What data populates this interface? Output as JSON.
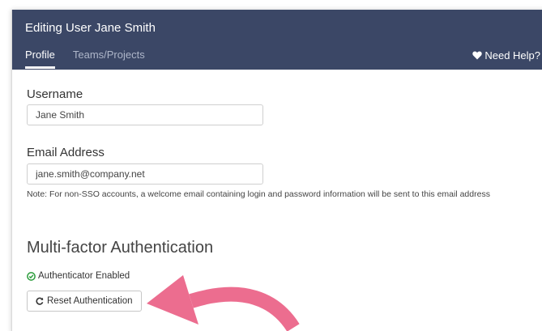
{
  "header": {
    "title": "Editing User Jane Smith",
    "tabs": [
      {
        "label": "Profile",
        "active": true
      },
      {
        "label": "Teams/Projects",
        "active": false
      }
    ],
    "help_label": "Need Help?"
  },
  "form": {
    "username": {
      "label": "Username",
      "value": "Jane Smith"
    },
    "email": {
      "label": "Email Address",
      "value": "jane.smith@company.net"
    },
    "note": "Note: For non-SSO accounts, a welcome email containing login and password information will be sent to this email address"
  },
  "mfa": {
    "title": "Multi-factor Authentication",
    "status": "Authenticator Enabled",
    "reset_label": "Reset Authentication"
  },
  "colors": {
    "header_bg": "#3b4766",
    "status_ok": "#2e9e3e",
    "annotation_arrow": "#ec6d8f"
  },
  "icons": {
    "help": "heart-icon",
    "status": "check-circle-icon",
    "reset": "refresh-icon",
    "annotation": "pink-arrow-icon"
  }
}
